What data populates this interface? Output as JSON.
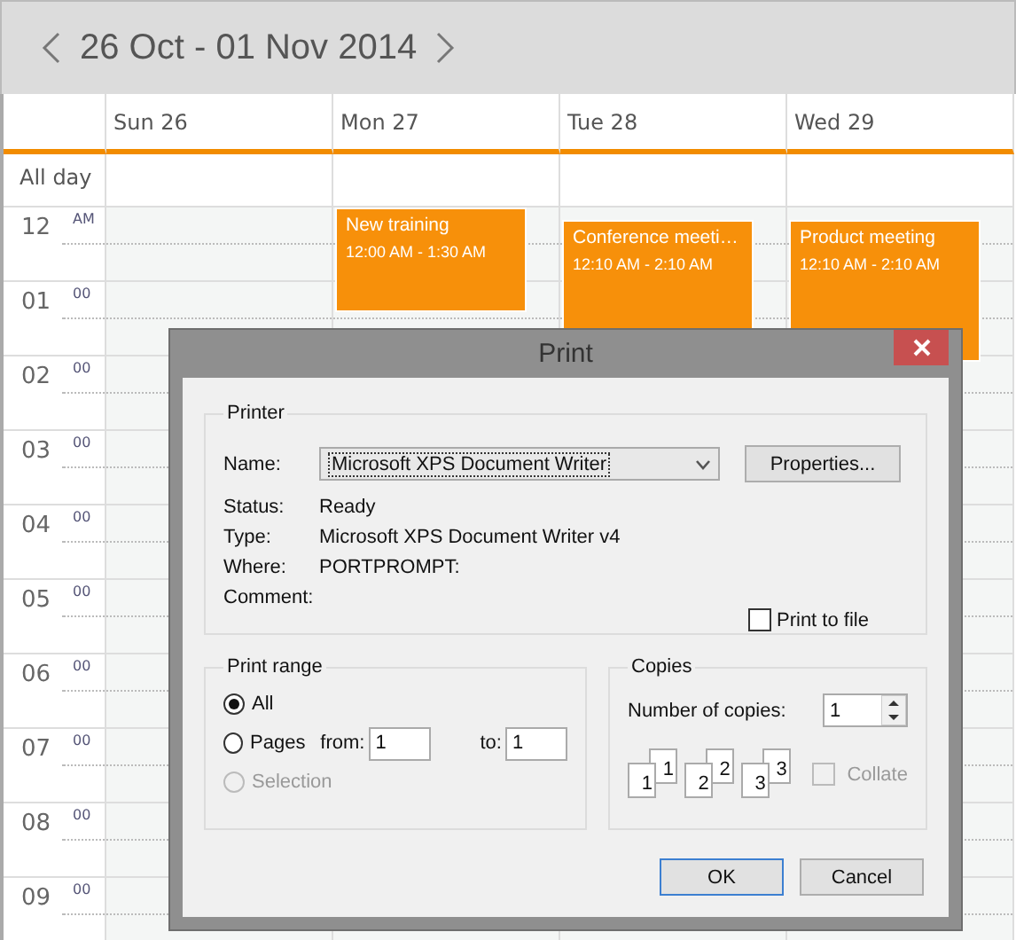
{
  "header": {
    "title": "26 Oct - 01 Nov 2014"
  },
  "days": [
    {
      "label": "Sun 26"
    },
    {
      "label": "Mon 27",
      "events": [
        {
          "title": "New training",
          "time": "12:00 AM - 1:30 AM"
        }
      ]
    },
    {
      "label": "Tue 28",
      "events": [
        {
          "title": "Conference meeti…",
          "time": "12:10 AM - 2:10 AM"
        }
      ]
    },
    {
      "label": "Wed 29",
      "events": [
        {
          "title": "Product meeting",
          "time": "12:10 AM - 2:10 AM"
        }
      ]
    }
  ],
  "all_day_label": "All day",
  "hours": [
    {
      "hour": "12",
      "suffix": "AM"
    },
    {
      "hour": "01",
      "suffix": "00"
    },
    {
      "hour": "02",
      "suffix": "00"
    },
    {
      "hour": "03",
      "suffix": "00"
    },
    {
      "hour": "04",
      "suffix": "00"
    },
    {
      "hour": "05",
      "suffix": "00"
    },
    {
      "hour": "06",
      "suffix": "00"
    },
    {
      "hour": "07",
      "suffix": "00"
    },
    {
      "hour": "08",
      "suffix": "00"
    },
    {
      "hour": "09",
      "suffix": "00"
    }
  ],
  "dialog": {
    "title": "Print",
    "printer": {
      "legend": "Printer",
      "name_label": "Name:",
      "name_value": "Microsoft XPS Document Writer",
      "properties_button": "Properties...",
      "info": [
        {
          "label": "Status:",
          "value": "Ready"
        },
        {
          "label": "Type:",
          "value": "Microsoft XPS Document Writer v4"
        },
        {
          "label": "Where:",
          "value": "PORTPROMPT:"
        },
        {
          "label": "Comment:"
        }
      ],
      "print_to_file": {
        "label": "Print to file",
        "checked": false
      }
    },
    "print_range": {
      "legend": "Print range",
      "options": [
        {
          "label": "All",
          "selected": true,
          "disabled": false
        },
        {
          "label": "Pages",
          "selected": false,
          "disabled": false
        },
        {
          "label": "Selection",
          "selected": false,
          "disabled": true
        }
      ],
      "from_label": "from:",
      "from_value": "1",
      "to_label": "to:",
      "to_value": "1"
    },
    "copies": {
      "legend": "Copies",
      "number_label": "Number of copies:",
      "number_value": "1",
      "page_icons": [
        {
          "front": "1",
          "back": "1"
        },
        {
          "front": "2",
          "back": "2"
        },
        {
          "front": "3",
          "back": "3"
        }
      ],
      "collate": {
        "label": "Collate",
        "checked": false,
        "disabled": true
      }
    },
    "buttons": [
      {
        "label": "OK",
        "default": true
      },
      {
        "label": "Cancel",
        "default": false
      }
    ]
  }
}
